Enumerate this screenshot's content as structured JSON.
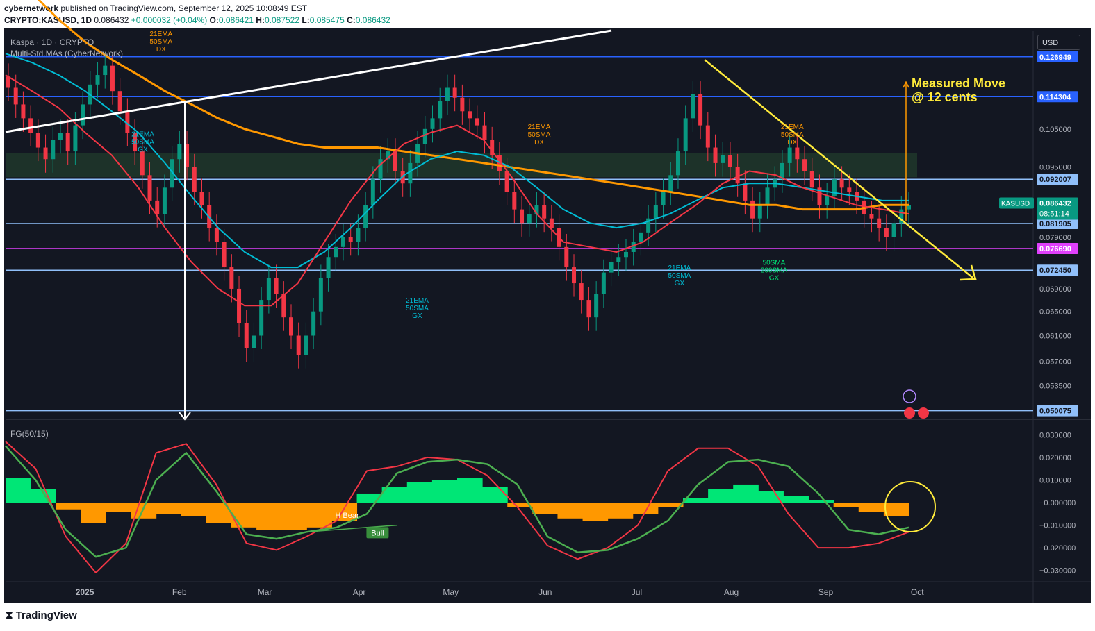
{
  "header": {
    "author": "cybernetwork",
    "published_text": "published on TradingView.com, September 12, 2025 10:08:49 EST",
    "symbol": "CRYPTO:KASUSD, 1D",
    "last": "0.086432",
    "change": "+0.000032 (+0.04%)",
    "o_label": "O:",
    "o": "0.086421",
    "h_label": "H:",
    "h": "0.087522",
    "l_label": "L:",
    "l": "0.085475",
    "c_label": "C:",
    "c": "0.086432"
  },
  "legend": {
    "title": "Kaspa · 1D · CRYPTO",
    "indicator": "Multi-Std.MAs (CyberNetwork)",
    "oscillator": "FG(50/15)"
  },
  "currency_button": "USD",
  "footer": {
    "logo": "TradingView"
  },
  "colors": {
    "background": "#131722",
    "bull": "#089981",
    "bear": "#f23645",
    "ema21": "#f23645",
    "sma50": "#00bcd4",
    "sma200": "#ff9800",
    "band": "#2962ff",
    "trend_yellow": "#ffeb3b",
    "hline": "#90bff9",
    "magenta": "#e040fb"
  },
  "chart_data": [
    {
      "type": "line",
      "title": "Kaspa · 1D · CRYPTO",
      "y_scale": "log",
      "ylim": [
        0.0495,
        0.136
      ],
      "price_ticks": [
        "0.105000",
        "0.095000",
        "0.079000",
        "0.069000",
        "0.065000",
        "0.061000",
        "0.057000",
        "0.053500"
      ],
      "x_ticks": [
        "2025",
        "Feb",
        "Mar",
        "Apr",
        "May",
        "Jun",
        "Jul",
        "Aug",
        "Sep",
        "Oct"
      ],
      "x_tick_dates": [
        "2025-01-01",
        "2025-02-01",
        "2025-03-01",
        "2025-04-01",
        "2025-05-01",
        "2025-06-01",
        "2025-07-01",
        "2025-08-01",
        "2025-09-01",
        "2025-10-01"
      ],
      "x_range": [
        "2024-12-06",
        "2025-11-08"
      ],
      "last_price_label": {
        "symbol": "KASUSD",
        "price": "0.086432",
        "countdown": "08:51:14"
      },
      "price_levels": [
        {
          "value": 0.126949,
          "label": "0.126949",
          "color": "#2962ff"
        },
        {
          "value": 0.114304,
          "label": "0.114304",
          "color": "#2962ff"
        },
        {
          "value": 0.092007,
          "label": "0.092007",
          "color": "#90bff9"
        },
        {
          "value": 0.081905,
          "label": "0.081905",
          "color": "#90bff9"
        },
        {
          "value": 0.07669,
          "label": "0.076690",
          "color": "#e040fb"
        },
        {
          "value": 0.07245,
          "label": "0.072450",
          "color": "#90bff9"
        },
        {
          "value": 0.050075,
          "label": "0.050075",
          "color": "#90bff9"
        }
      ],
      "candles_close": [
        0.117,
        0.112,
        0.108,
        0.104,
        0.1,
        0.097,
        0.102,
        0.104,
        0.099,
        0.106,
        0.112,
        0.118,
        0.121,
        0.124,
        0.116,
        0.11,
        0.104,
        0.099,
        0.093,
        0.087,
        0.084,
        0.09,
        0.097,
        0.101,
        0.095,
        0.089,
        0.086,
        0.081,
        0.078,
        0.073,
        0.069,
        0.063,
        0.059,
        0.061,
        0.067,
        0.071,
        0.068,
        0.064,
        0.061,
        0.058,
        0.061,
        0.065,
        0.071,
        0.075,
        0.077,
        0.079,
        0.078,
        0.081,
        0.086,
        0.092,
        0.097,
        0.099,
        0.094,
        0.091,
        0.096,
        0.101,
        0.105,
        0.108,
        0.113,
        0.117,
        0.114,
        0.11,
        0.108,
        0.106,
        0.102,
        0.098,
        0.094,
        0.089,
        0.085,
        0.082,
        0.084,
        0.086,
        0.083,
        0.081,
        0.077,
        0.073,
        0.07,
        0.067,
        0.064,
        0.068,
        0.072,
        0.074,
        0.075,
        0.076,
        0.078,
        0.08,
        0.083,
        0.086,
        0.089,
        0.093,
        0.099,
        0.108,
        0.115,
        0.106,
        0.1,
        0.096,
        0.098,
        0.095,
        0.091,
        0.087,
        0.083,
        0.086,
        0.09,
        0.092,
        0.096,
        0.1,
        0.097,
        0.094,
        0.09,
        0.086,
        0.088,
        0.092,
        0.09,
        0.089,
        0.087,
        0.084,
        0.083,
        0.081,
        0.079,
        0.082,
        0.085,
        0.086
      ],
      "ema21": [
        0.121,
        0.116,
        0.111,
        0.104,
        0.098,
        0.09,
        0.081,
        0.074,
        0.069,
        0.066,
        0.066,
        0.07,
        0.078,
        0.087,
        0.095,
        0.101,
        0.104,
        0.106,
        0.102,
        0.093,
        0.084,
        0.078,
        0.077,
        0.076,
        0.078,
        0.082,
        0.086,
        0.091,
        0.094,
        0.093,
        0.09,
        0.088,
        0.086,
        0.085,
        0.084
      ],
      "sma50": [
        0.128,
        0.125,
        0.121,
        0.116,
        0.11,
        0.104,
        0.096,
        0.088,
        0.081,
        0.076,
        0.073,
        0.073,
        0.076,
        0.081,
        0.087,
        0.093,
        0.097,
        0.099,
        0.098,
        0.095,
        0.09,
        0.085,
        0.082,
        0.081,
        0.082,
        0.084,
        0.087,
        0.09,
        0.091,
        0.091,
        0.09,
        0.089,
        0.088,
        0.087,
        0.087
      ],
      "sma200": [
        0.16,
        0.15,
        0.14,
        0.132,
        0.126,
        0.121,
        0.116,
        0.112,
        0.108,
        0.105,
        0.103,
        0.101,
        0.1,
        0.1,
        0.1,
        0.099,
        0.098,
        0.097,
        0.096,
        0.095,
        0.094,
        0.093,
        0.092,
        0.091,
        0.09,
        0.089,
        0.088,
        0.087,
        0.086,
        0.086,
        0.085,
        0.085,
        0.085,
        0.086,
        0.086
      ],
      "annotations": [
        {
          "text": [
            "21EMA",
            "50SMA",
            "DX"
          ],
          "color": "#ff9800",
          "date": "2025-01-26",
          "price": 0.134
        },
        {
          "text": [
            "21EMA",
            "50SMA",
            "GX"
          ],
          "color": "#00bcd4",
          "date": "2025-01-20",
          "price": 0.103
        },
        {
          "text": [
            "21EMA",
            "50SMA",
            "DX"
          ],
          "color": "#ff9800",
          "date": "2025-05-30",
          "price": 0.105
        },
        {
          "text": [
            "21EMA",
            "50SMA",
            "GX"
          ],
          "color": "#00bcd4",
          "date": "2025-04-20",
          "price": 0.0665
        },
        {
          "text": [
            "21EMA",
            "50SMA",
            "DX"
          ],
          "color": "#ff9800",
          "date": "2025-08-21",
          "price": 0.105
        },
        {
          "text": [
            "21EMA",
            "50SMA",
            "GX"
          ],
          "color": "#00bcd4",
          "date": "2025-07-15",
          "price": 0.0725
        },
        {
          "text": [
            "50SMA",
            "200SMA",
            "GX"
          ],
          "color": "#00e676",
          "date": "2025-08-15",
          "price": 0.0735
        }
      ],
      "measured_move": [
        "Measured Move",
        "@ 12 cents"
      ]
    },
    {
      "type": "area",
      "title": "FG(50/15)",
      "ylim": [
        -0.035,
        0.035
      ],
      "ticks": [
        "0.030000",
        "0.020000",
        "0.010000",
        "−0.000000",
        "−0.010000",
        "−0.020000",
        "−0.030000"
      ],
      "histogram": [
        0.011,
        0.006,
        -0.003,
        -0.009,
        -0.004,
        -0.007,
        -0.005,
        -0.006,
        -0.009,
        -0.011,
        -0.012,
        -0.012,
        -0.011,
        -0.008,
        0.004,
        0.007,
        0.009,
        0.01,
        0.011,
        0.007,
        -0.002,
        -0.005,
        -0.007,
        -0.008,
        -0.007,
        -0.005,
        -0.002,
        0.002,
        0.006,
        0.008,
        0.005,
        0.003,
        0.001,
        -0.002,
        -0.004,
        -0.006
      ],
      "fast": [
        0.025,
        0.01,
        -0.012,
        -0.024,
        -0.02,
        0.01,
        0.022,
        0.005,
        -0.014,
        -0.016,
        -0.013,
        -0.011,
        -0.005,
        0.013,
        0.018,
        0.019,
        0.017,
        0.008,
        -0.015,
        -0.022,
        -0.021,
        -0.016,
        -0.008,
        0.008,
        0.018,
        0.019,
        0.016,
        0.004,
        -0.012,
        -0.014,
        -0.011
      ],
      "slow": [
        0.027,
        0.015,
        -0.015,
        -0.031,
        -0.018,
        0.022,
        0.026,
        0.008,
        -0.018,
        -0.021,
        -0.015,
        -0.008,
        0.014,
        0.016,
        0.02,
        0.019,
        0.012,
        -0.002,
        -0.019,
        -0.025,
        -0.02,
        -0.01,
        0.014,
        0.024,
        0.024,
        0.016,
        -0.005,
        -0.02,
        -0.02,
        -0.018,
        -0.013
      ],
      "labels": [
        {
          "text": "H Bear",
          "date": "2025-03-28",
          "value": -0.0055
        },
        {
          "text": "Bull",
          "date": "2025-04-07",
          "value": -0.0133
        }
      ]
    }
  ]
}
